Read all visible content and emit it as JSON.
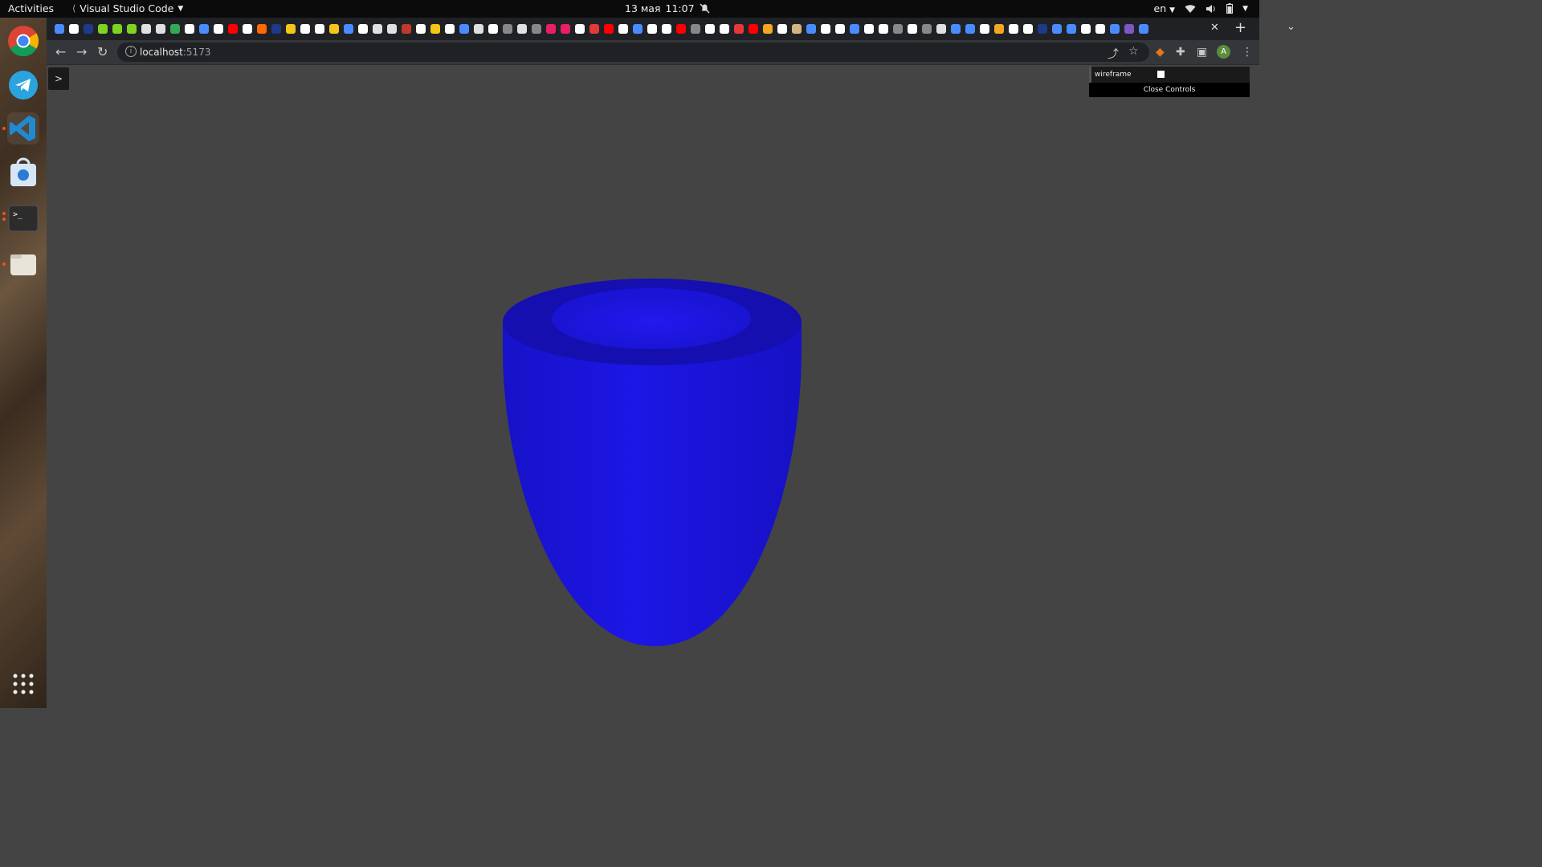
{
  "topbar": {
    "activities": "Activities",
    "app_name": "Visual Studio Code",
    "date": "13 мая",
    "time": "11:07",
    "lang": "en"
  },
  "browser": {
    "url_host": "localhost",
    "url_port": ":5173"
  },
  "dock": {
    "items": [
      "chrome-icon",
      "telegram-icon",
      "vscode-icon",
      "software-store-icon",
      "terminal-icon",
      "files-icon",
      "app-grid-icon"
    ]
  },
  "app": {
    "toggle_label": ">",
    "controls": {
      "wireframe_label": "wireframe",
      "wireframe_checked": false,
      "close_label": "Close Controls"
    }
  },
  "scene": {
    "object": "bowl",
    "color": "#1a14e0",
    "background": "#444444"
  },
  "profile": {
    "initial": "A"
  }
}
